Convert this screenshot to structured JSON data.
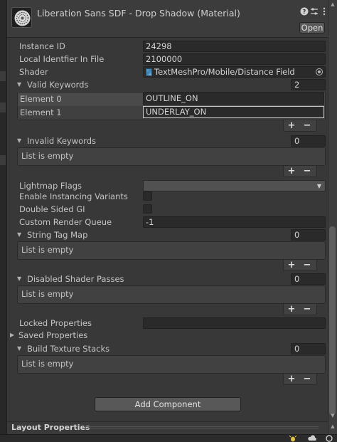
{
  "header": {
    "title": "Liberation Sans SDF - Drop Shadow (Material)",
    "open_label": "Open",
    "icons": [
      "help-icon",
      "presets-icon",
      "more-options-icon"
    ]
  },
  "fields": {
    "instance_id_label": "Instance ID",
    "instance_id_value": "24298",
    "local_identifier_label": "Local Identfier In File",
    "local_identifier_value": "2100000",
    "shader_label": "Shader",
    "shader_value": "TextMeshPro/Mobile/Distance Field"
  },
  "valid_keywords": {
    "label": "Valid Keywords",
    "count": "2",
    "elements": [
      {
        "label": "Element 0",
        "value": "OUTLINE_ON"
      },
      {
        "label": "Element 1",
        "value": "UNDERLAY_ON"
      }
    ]
  },
  "invalid_keywords": {
    "label": "Invalid Keywords",
    "count": "0",
    "empty_text": "List is empty"
  },
  "settings": {
    "lightmap_flags_label": "Lightmap Flags",
    "lightmap_flags_value": "",
    "enable_instancing_label": "Enable Instancing Variants",
    "enable_instancing_checked": false,
    "double_sided_gi_label": "Double Sided GI",
    "double_sided_gi_checked": false,
    "render_queue_label": "Custom Render Queue",
    "render_queue_value": "-1"
  },
  "string_tag_map": {
    "label": "String Tag Map",
    "count": "0",
    "empty_text": "List is empty"
  },
  "disabled_shader_passes": {
    "label": "Disabled Shader Passes",
    "count": "0",
    "empty_text": "List is empty"
  },
  "locked_properties": {
    "label": "Locked Properties",
    "value": ""
  },
  "saved_properties": {
    "label": "Saved Properties"
  },
  "build_texture_stacks": {
    "label": "Build Texture Stacks",
    "count": "0",
    "empty_text": "List is empty"
  },
  "buttons": {
    "plus": "+",
    "minus": "−",
    "add_component": "Add Component"
  },
  "layout_properties": {
    "label": "Layout Properties"
  },
  "colors": {
    "background": "#383838",
    "field": "#2a2a2a",
    "text": "#c4c4c4",
    "button": "#585858"
  }
}
